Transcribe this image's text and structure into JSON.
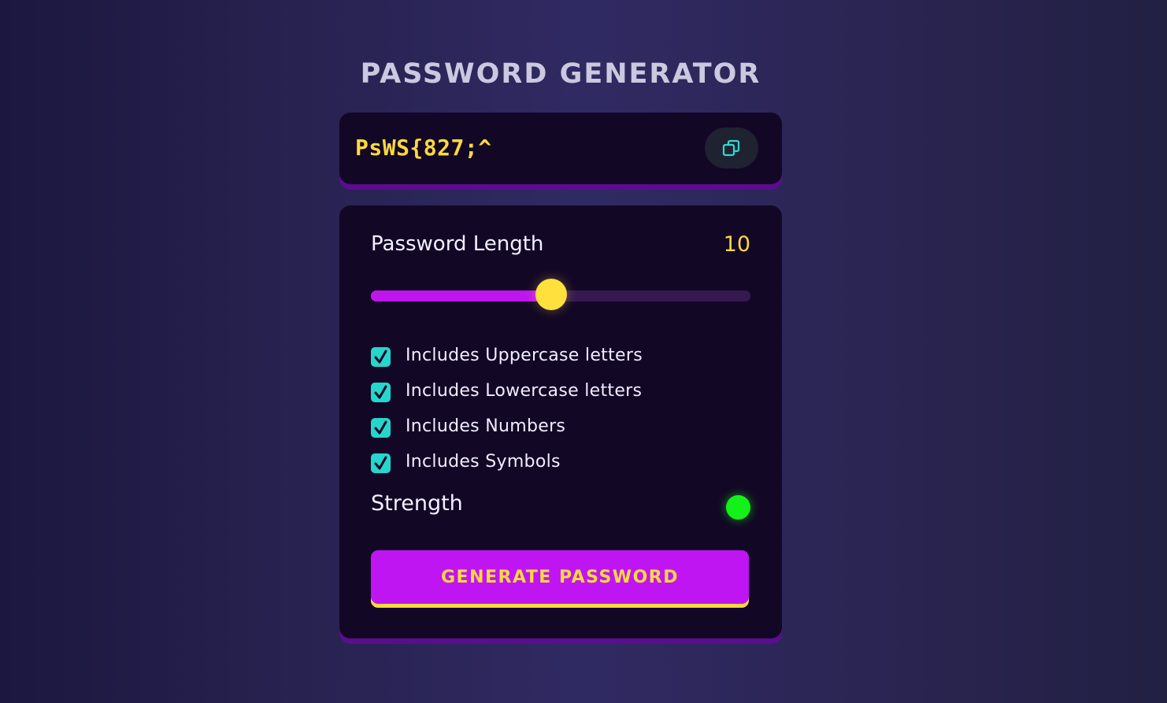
{
  "app": {
    "title": "PASSWORD GENERATOR"
  },
  "password": {
    "value": "PsWS{827;^",
    "copy_icon": "copy-icon"
  },
  "length": {
    "label": "Password Length",
    "value": "10",
    "slider_fraction": 0.475
  },
  "options": [
    {
      "label": "Includes Uppercase letters",
      "checked": true
    },
    {
      "label": "Includes Lowercase letters",
      "checked": true
    },
    {
      "label": "Includes Numbers",
      "checked": true
    },
    {
      "label": "Includes Symbols",
      "checked": true
    }
  ],
  "strength": {
    "label": "Strength",
    "indicator_color": "#13f01a"
  },
  "generate": {
    "label": "GENERATE PASSWORD"
  },
  "colors": {
    "accent_yellow": "#ffd93d",
    "accent_purple": "#bf15f3",
    "checkbox_teal": "#25d6cc",
    "panel_bg": "#130726"
  }
}
